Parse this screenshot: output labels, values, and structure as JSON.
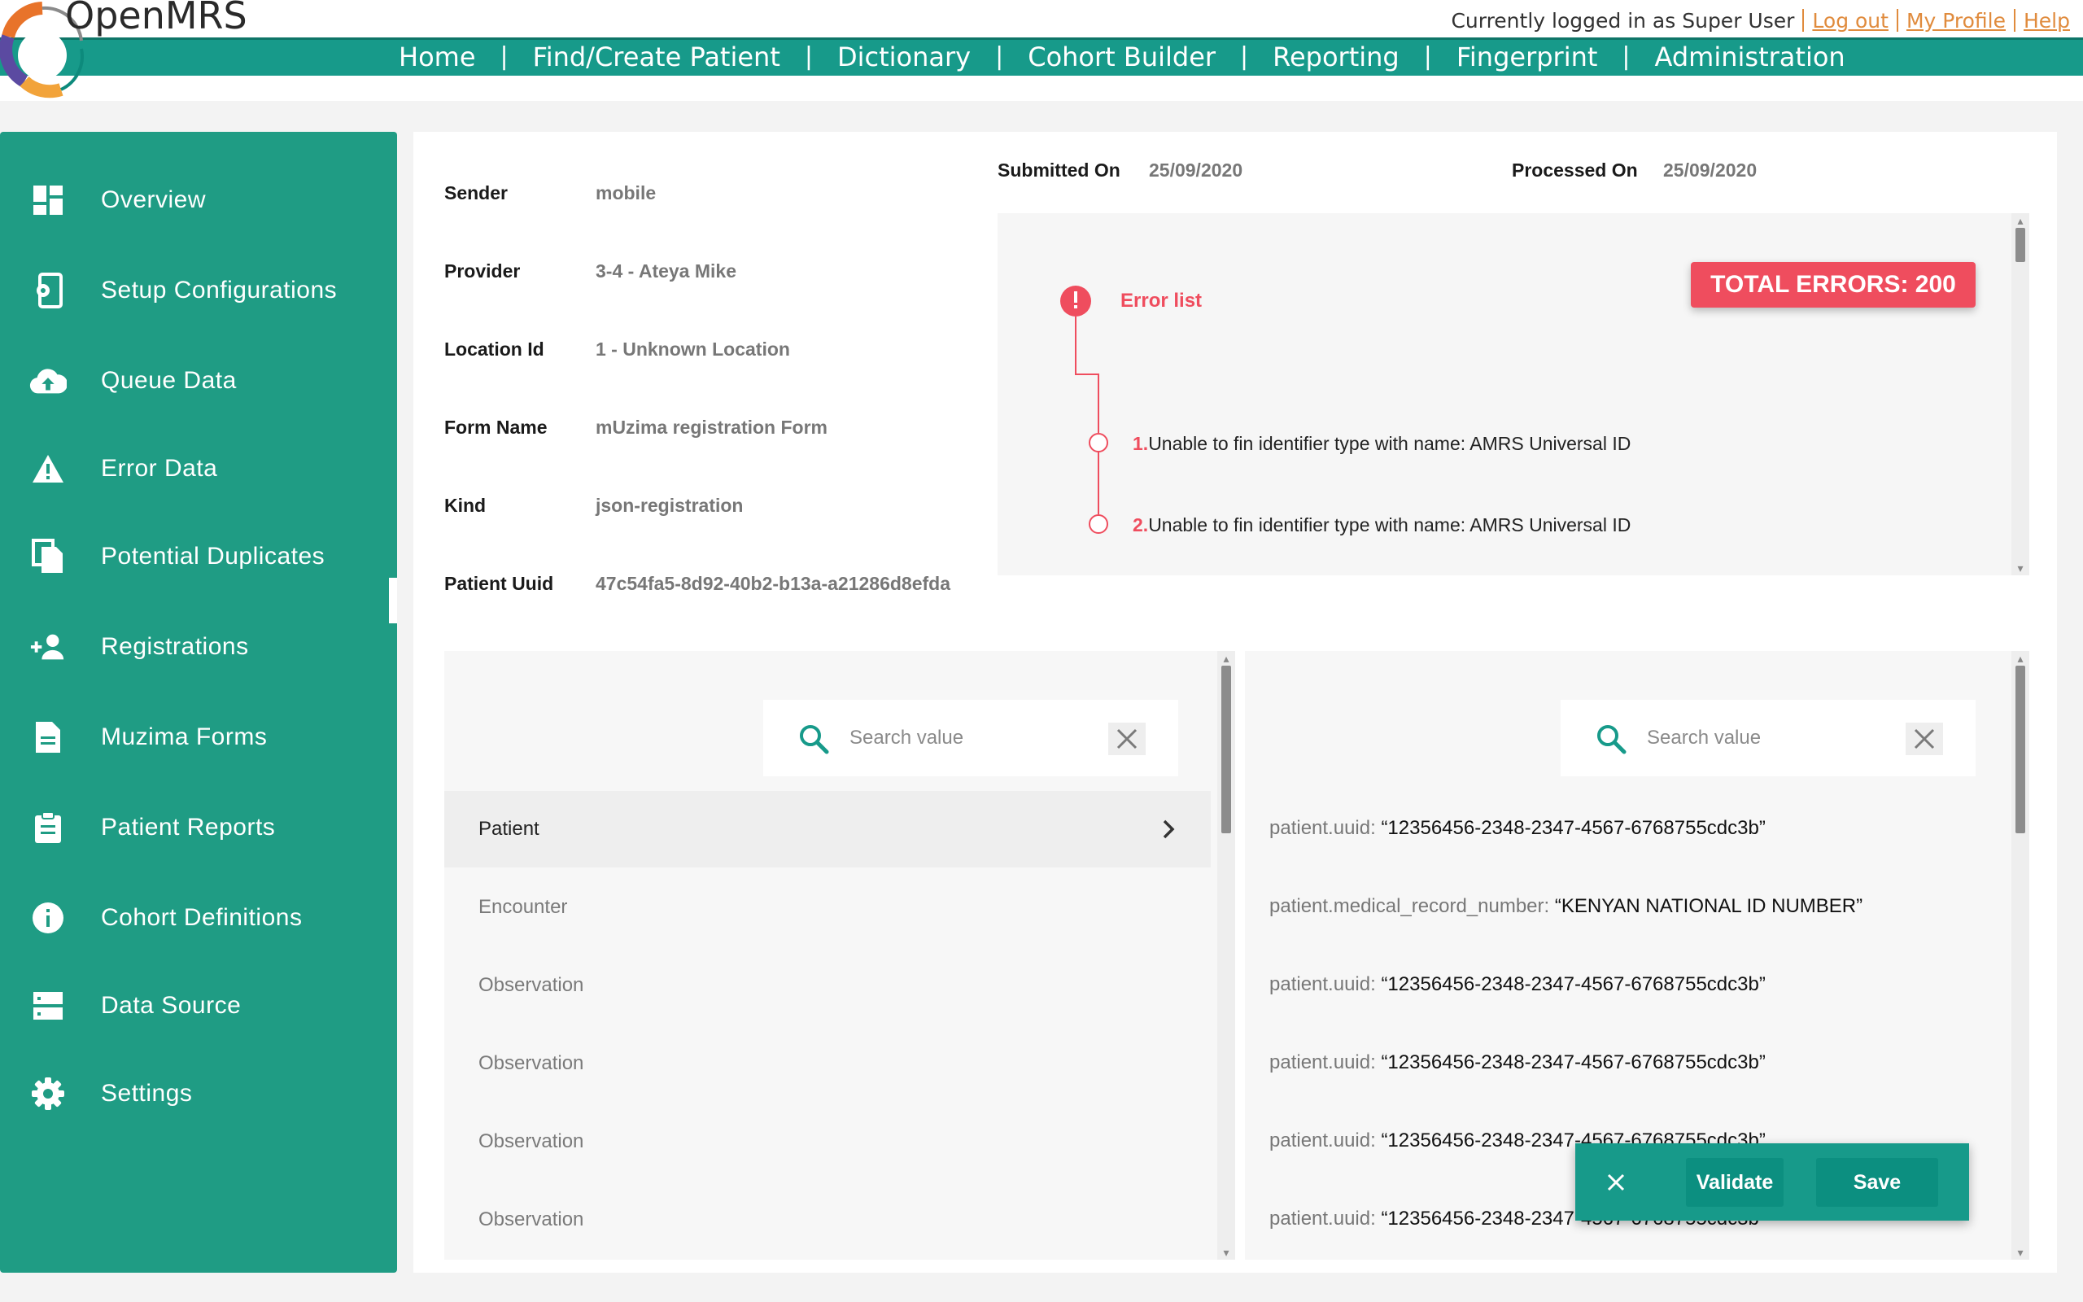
{
  "header": {
    "brand": "OpenMRS",
    "nav": [
      "Home",
      "Find/Create Patient",
      "Dictionary",
      "Cohort Builder",
      "Reporting",
      "Fingerprint",
      "Administration"
    ],
    "logged_in_text": "Currently logged in as Super User",
    "logout": "Log out",
    "profile": "My Profile",
    "help": "Help"
  },
  "sidebar": {
    "items": [
      {
        "label": "Overview",
        "icon": "dashboard-icon"
      },
      {
        "label": "Setup Configurations",
        "icon": "device-settings-icon"
      },
      {
        "label": "Queue Data",
        "icon": "cloud-upload-icon"
      },
      {
        "label": "Error Data",
        "icon": "warning-icon"
      },
      {
        "label": "Potential Duplicates",
        "icon": "copy-icon"
      },
      {
        "label": "Registrations",
        "icon": "add-user-icon"
      },
      {
        "label": "Muzima Forms",
        "icon": "document-icon"
      },
      {
        "label": "Patient Reports",
        "icon": "clipboard-icon"
      },
      {
        "label": "Cohort Definitions",
        "icon": "info-icon"
      },
      {
        "label": "Data Source",
        "icon": "storage-icon"
      },
      {
        "label": "Settings",
        "icon": "gear-icon"
      }
    ],
    "active": "Error Data"
  },
  "details": {
    "sender_label": "Sender",
    "sender": "mobile",
    "provider_label": "Provider",
    "provider": "3-4 - Ateya Mike",
    "location_label": "Location Id",
    "location": "1 - Unknown Location",
    "form_label": "Form Name",
    "form": "mUzima registration Form",
    "kind_label": "Kind",
    "kind": "json-registration",
    "uuid_label": "Patient Uuid",
    "uuid": "47c54fa5-8d92-40b2-b13a-a21286d8efda",
    "submitted_label": "Submitted On",
    "submitted": "25/09/2020",
    "processed_label": "Processed On",
    "processed": "25/09/2020"
  },
  "errors": {
    "total_label": "TOTAL ERRORS: 200",
    "title": "Error list",
    "items": [
      {
        "num": "1.",
        "text": "Unable to fin identifier type with name: AMRS Universal ID"
      },
      {
        "num": "2.",
        "text": "Unable to fin identifier type with name: AMRS Universal ID"
      }
    ]
  },
  "left_panel": {
    "search_placeholder": "Search value",
    "rows": [
      "Patient",
      "Encounter",
      "Observation",
      "Observation",
      "Observation",
      "Observation"
    ]
  },
  "right_panel": {
    "search_placeholder": "Search value",
    "rows": [
      {
        "key": "patient.uuid: ",
        "value": "“12356456-2348-2347-4567-6768755cdc3b”"
      },
      {
        "key": "patient.medical_record_number: ",
        "value": "“KENYAN NATIONAL ID NUMBER”"
      },
      {
        "key": "patient.uuid: ",
        "value": "“12356456-2348-2347-4567-6768755cdc3b”"
      },
      {
        "key": "patient.uuid: ",
        "value": "“12356456-2348-2347-4567-6768755cdc3b”"
      },
      {
        "key": "patient.uuid: ",
        "value": "“12356456-2348-2347-4567-6768755cdc3b”"
      },
      {
        "key": "patient.uuid: ",
        "value": "“12356456-2348-2347-4567-6768755cdc3b”"
      }
    ]
  },
  "actions": {
    "validate": "Validate",
    "save": "Save"
  },
  "colors": {
    "teal": "#1f9c84",
    "header_teal": "#179a8a",
    "error_red": "#ef4d5e",
    "link_orange": "#e08b3d"
  }
}
